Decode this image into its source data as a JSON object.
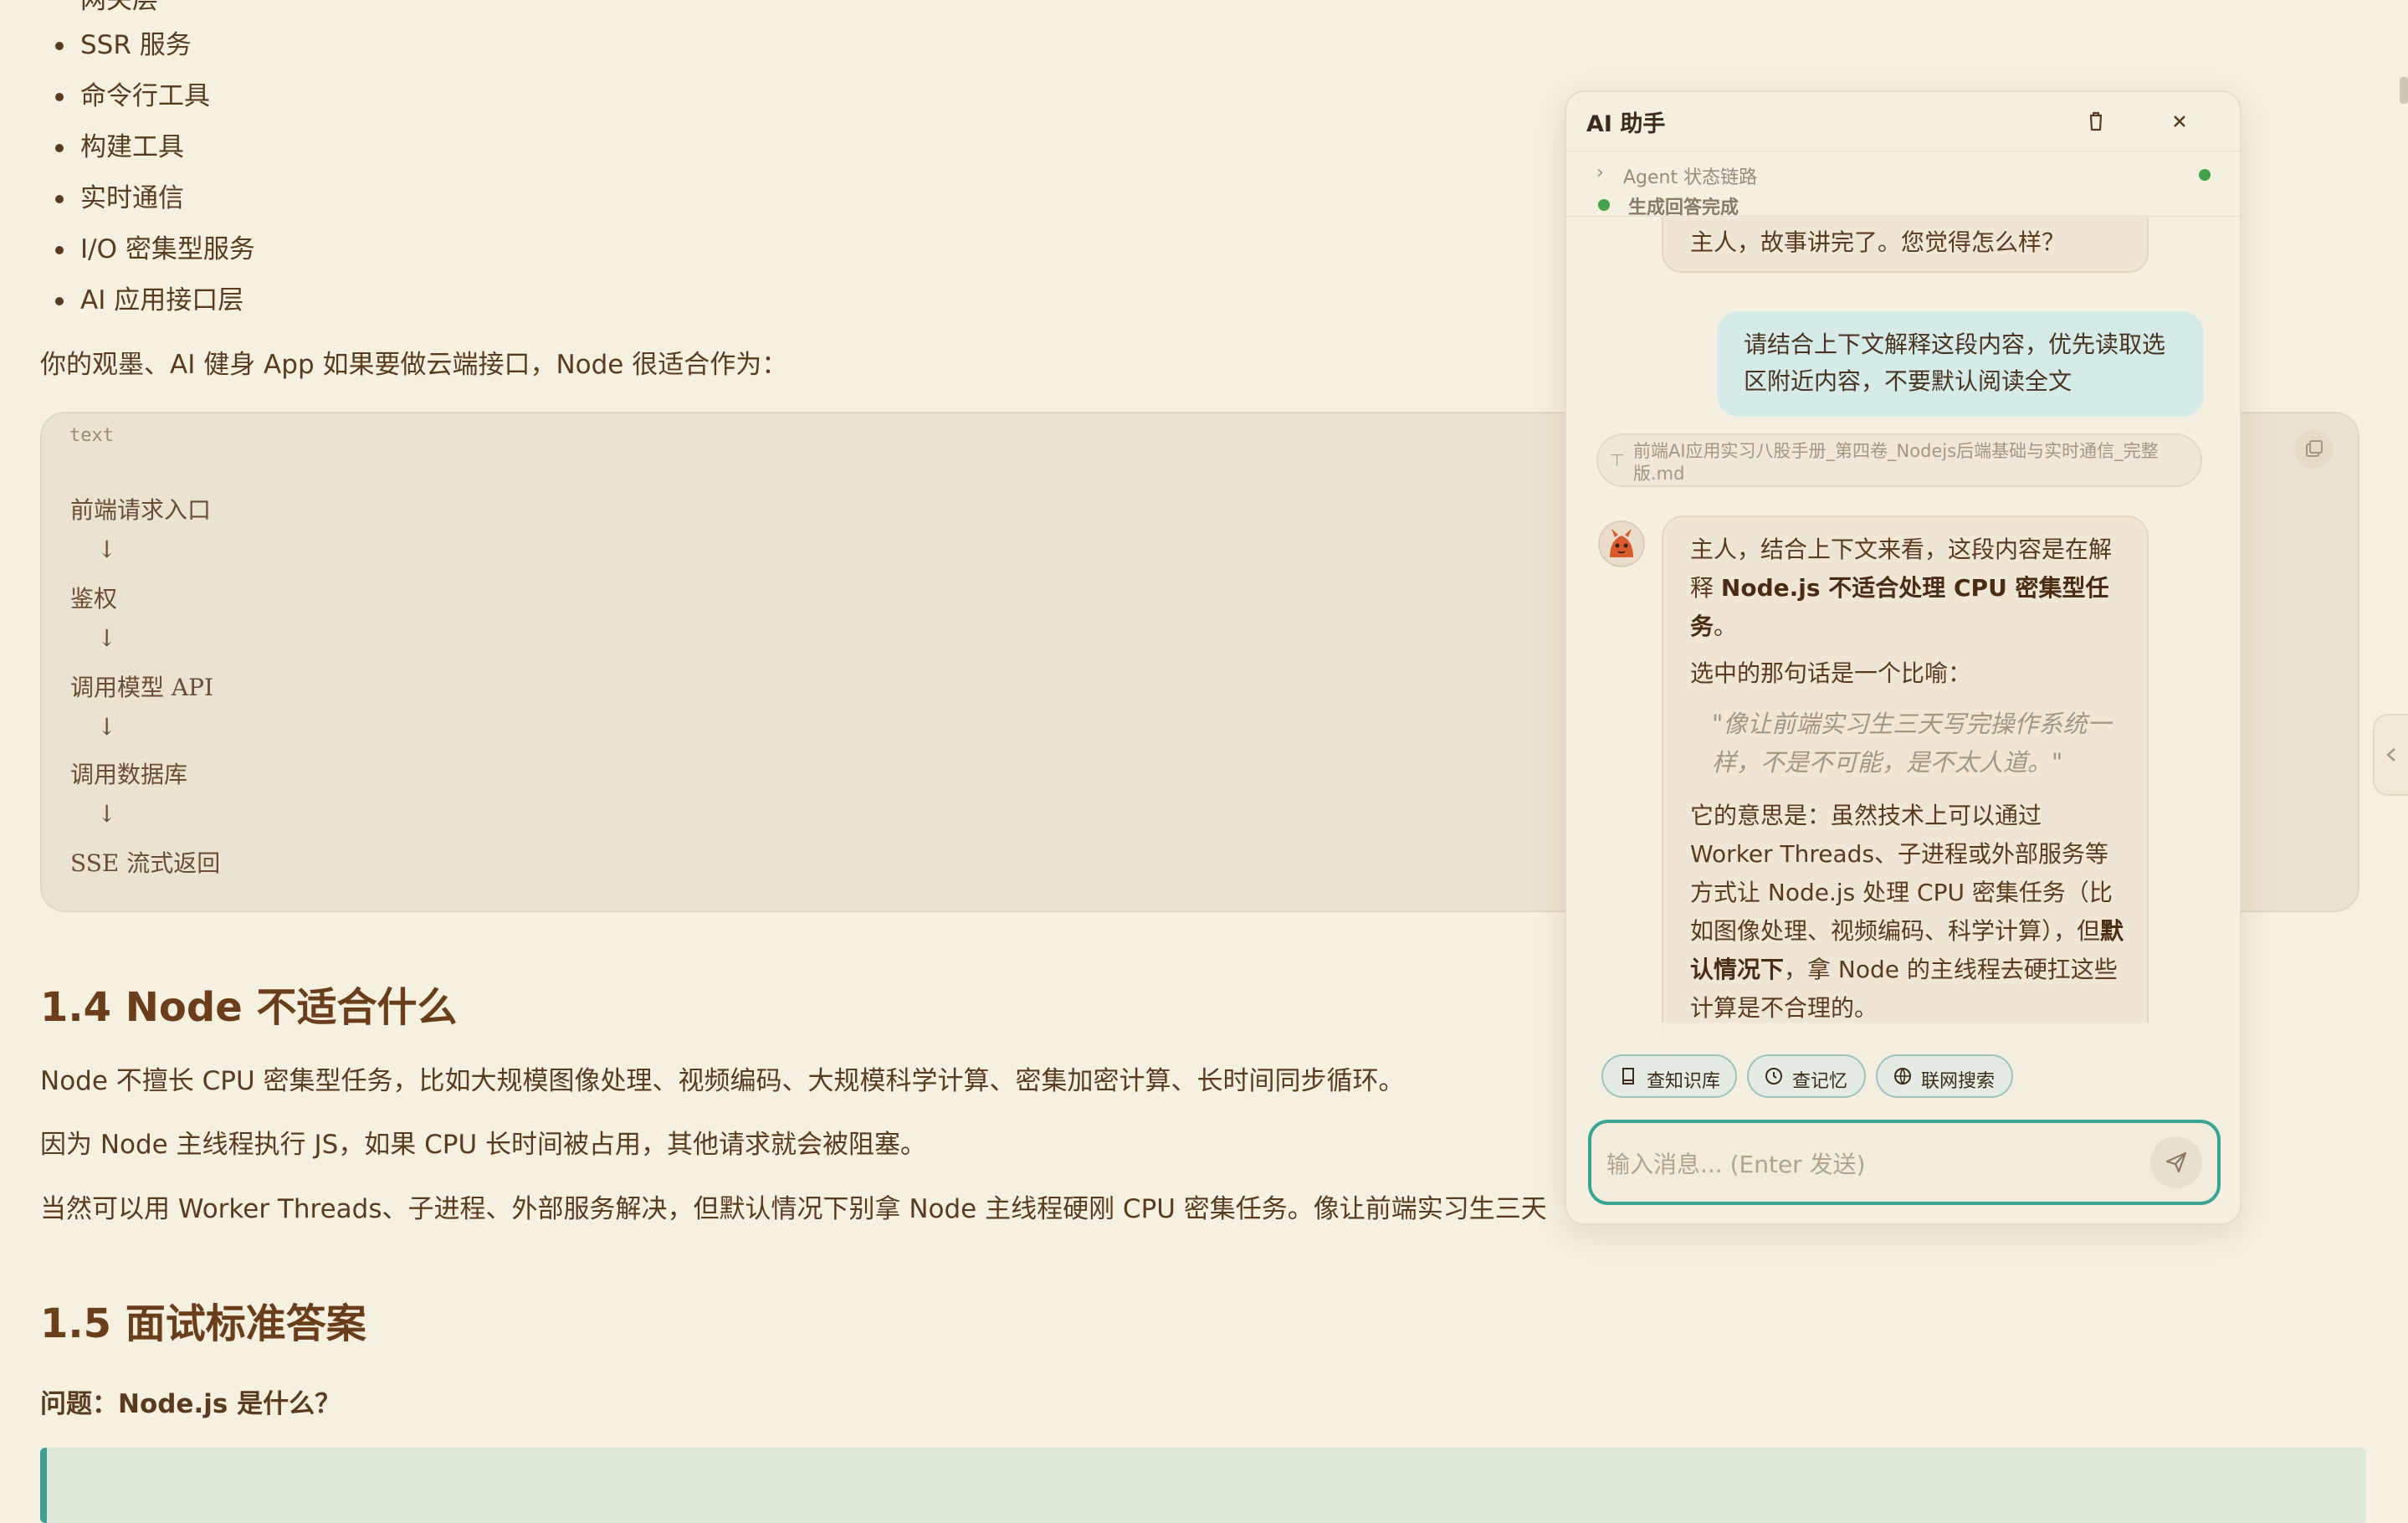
{
  "document": {
    "bullets_top_partial": "网关层",
    "bullets": [
      "SSR 服务",
      "命令行工具",
      "构建工具",
      "实时通信",
      "I/O 密集型服务",
      "AI 应用接口层"
    ],
    "intro_para": "你的观墨、AI 健身 App 如果要做云端接口，Node 很适合作为：",
    "code": {
      "lang": "text",
      "lines": [
        "前端请求入口",
        "↓",
        "鉴权",
        "↓",
        "调用模型 API",
        "↓",
        "调用数据库",
        "↓",
        "SSE 流式返回"
      ]
    },
    "section_14": {
      "heading": "1.4 Node 不适合什么",
      "p1": "Node 不擅长 CPU 密集型任务，比如大规模图像处理、视频编码、大规模科学计算、密集加密计算、长时间同步循环。",
      "p2": "因为 Node 主线程执行 JS，如果 CPU 长时间被占用，其他请求就会被阻塞。",
      "p3": "当然可以用 Worker Threads、子进程、外部服务解决，但默认情况下别拿 Node 主线程硬刚 CPU 密集任务。像让前端实习生三天"
    },
    "section_15": {
      "heading": "1.5 面试标准答案",
      "question": "问题：Node.js 是什么？"
    }
  },
  "ai_panel": {
    "title": "AI 助手",
    "status": {
      "title": "Agent 状态链路",
      "done": "生成回答完成"
    },
    "messages": {
      "ai_prev": "主人，故事讲完了。您觉得怎么样？",
      "user": "请结合上下文解释这段内容，优先读取选区附近内容，不要默认阅读全文",
      "attachment": "前端AI应用实习八股手册_第四卷_Nodejs后端基础与实时通信_完整版.md",
      "ai_reply": {
        "p1_pre": "主人，结合上下文来看，这段内容是在解释 ",
        "p1_bold": "Node.js 不适合处理 CPU 密集型任务",
        "p1_post": "。",
        "p2": "选中的那句话是一个比喻：",
        "quote": "\"像让前端实习生三天写完操作系统一样，不是不可能，是不太人道。\"",
        "p3_pre": "它的意思是：虽然技术上可以通过 Worker Threads、子进程或外部服务等方式让 Node.js 处理 CPU 密集任务（比如图像处理、视频编码、科学计算），但",
        "p3_bold": "默认情况下",
        "p3_post": "，拿 Node 的主线程去硬扛这些计算是不合理的。"
      }
    },
    "tools": [
      "查知识库",
      "查记忆",
      "联网搜索"
    ],
    "input_placeholder": "输入消息... (Enter 发送)",
    "colors": {
      "accent": "#3aa595",
      "status_green": "#43a34a",
      "page_bg": "#f6f0e1"
    },
    "icons": [
      "trash-icon",
      "close-icon",
      "chevron-right-icon",
      "book-icon",
      "clock-icon",
      "globe-icon",
      "send-icon",
      "copy-icon",
      "file-icon"
    ]
  }
}
